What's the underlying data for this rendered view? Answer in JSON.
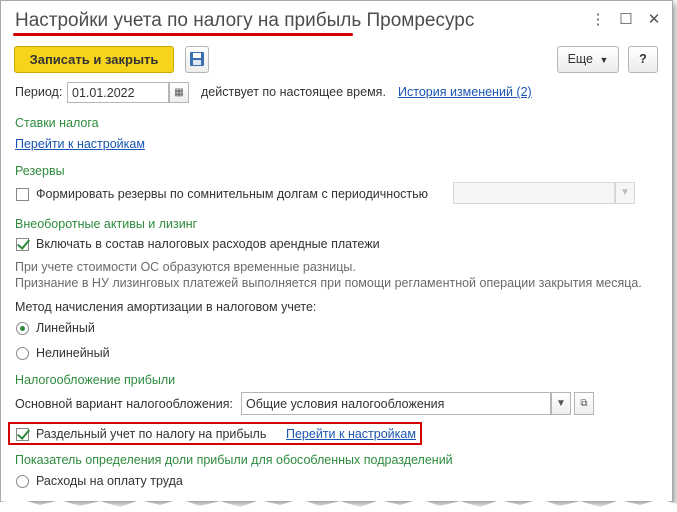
{
  "window": {
    "title": "Настройки учета по налогу на прибыль Промресурс",
    "controls": {
      "more": "⋮",
      "maximize": "☐",
      "close": "✕"
    }
  },
  "toolbar": {
    "save_close_label": "Записать и закрыть",
    "more_label": "Еще",
    "help_label": "?"
  },
  "period": {
    "label": "Период:",
    "value": "01.01.2022",
    "status_text": "действует по настоящее время.",
    "history_link": "История изменений (2)"
  },
  "tax_rates": {
    "title": "Ставки налога",
    "settings_link": "Перейти к настройкам"
  },
  "reserves": {
    "title": "Резервы",
    "checkbox_label": "Формировать резервы по сомнительным долгам с периодичностью",
    "checked": false,
    "periodicity_value": ""
  },
  "fixed_assets": {
    "title": "Внеоборотные активы и лизинг",
    "checkbox_label": "Включать в состав налоговых расходов арендные платежи",
    "checked": true,
    "hint_line1": "При учете стоимости ОС образуются временные разницы.",
    "hint_line2": "Признание в НУ лизинговых платежей выполняется при помощи регламентной операции закрытия месяца.",
    "method_label": "Метод начисления амортизации в налоговом учете:",
    "options": [
      "Линейный",
      "Нелинейный"
    ],
    "selected": "Линейный"
  },
  "profit_tax": {
    "title": "Налогообложение прибыли",
    "variant_label": "Основной вариант налогообложения:",
    "variant_value": "Общие условия налогообложения",
    "separate_label": "Раздельный учет по налогу на прибыль",
    "separate_checked": true,
    "separate_link": "Перейти к настройкам"
  },
  "share_indicator": {
    "title": "Показатель определения доли прибыли для обособленных подразделений",
    "option_label": "Расходы на оплату труда"
  },
  "colors": {
    "section_green": "#2e8b3e",
    "link_blue": "#1a55b3",
    "primary_yellow": "#f7d41c",
    "highlight_red": "#d40000"
  }
}
